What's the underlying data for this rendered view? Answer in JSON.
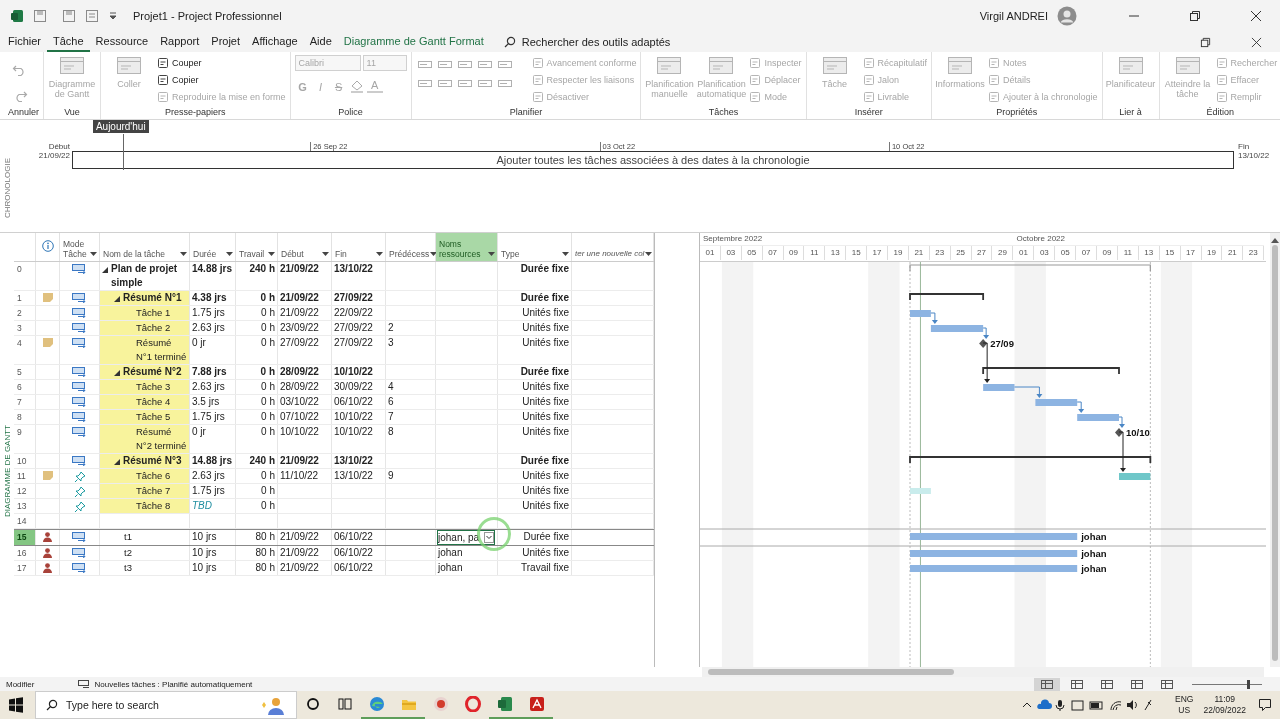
{
  "title_bar": {
    "title": "Projet1 - Project Professionnel",
    "user": "Virgil ANDREI"
  },
  "menu": {
    "tabs": [
      {
        "label": "Fichier",
        "selected": false,
        "kind": "standard"
      },
      {
        "label": "Tâche",
        "selected": true,
        "kind": "standard"
      },
      {
        "label": "Ressource",
        "selected": false,
        "kind": "standard"
      },
      {
        "label": "Rapport",
        "selected": false,
        "kind": "standard"
      },
      {
        "label": "Projet",
        "selected": false,
        "kind": "standard"
      },
      {
        "label": "Affichage",
        "selected": false,
        "kind": "standard"
      },
      {
        "label": "Aide",
        "selected": false,
        "kind": "standard"
      },
      {
        "label": "Diagramme de Gantt Format",
        "selected": false,
        "kind": "contextual"
      }
    ],
    "search": "Rechercher des outils adaptés"
  },
  "ribbon": {
    "groups": [
      {
        "label": "Annuler",
        "items": [
          {
            "kind": "undo",
            "disabled": true
          },
          {
            "kind": "redo",
            "disabled": true
          }
        ]
      },
      {
        "label": "Vue",
        "items": [
          {
            "kind": "large",
            "label": "Diagramme de Gantt",
            "disabled": true
          }
        ]
      },
      {
        "label": "Presse-papiers",
        "items": [
          {
            "kind": "large",
            "label": "Coller",
            "disabled": true
          },
          {
            "kind": "small",
            "label": "Couper",
            "disabled": false
          },
          {
            "kind": "small",
            "label": "Copier",
            "disabled": false
          },
          {
            "kind": "small",
            "label": "Reproduire la mise en forme",
            "disabled": true
          }
        ]
      },
      {
        "label": "Police",
        "items": [
          {
            "kind": "field",
            "label": "Calibri",
            "disabled": true
          },
          {
            "kind": "field",
            "label": "11",
            "disabled": true
          },
          {
            "kind": "bold",
            "label": "G",
            "disabled": true
          },
          {
            "kind": "italic",
            "label": "I",
            "disabled": true
          },
          {
            "kind": "strike",
            "label": "S",
            "disabled": true
          },
          {
            "kind": "fill",
            "disabled": true
          },
          {
            "kind": "fontcolor",
            "label": "A",
            "disabled": true
          }
        ]
      },
      {
        "label": "Planifier",
        "items": [
          {
            "kind": "tool",
            "disabled": true
          },
          {
            "kind": "tool",
            "disabled": true
          },
          {
            "kind": "tool",
            "disabled": true
          },
          {
            "kind": "tool",
            "disabled": true
          },
          {
            "kind": "tool",
            "disabled": true
          },
          {
            "kind": "tool",
            "disabled": true
          },
          {
            "kind": "tool",
            "disabled": true
          },
          {
            "kind": "tool",
            "disabled": true
          },
          {
            "kind": "tool",
            "disabled": true
          },
          {
            "kind": "tool",
            "disabled": true
          },
          {
            "kind": "small",
            "label": "Avancement conforme",
            "disabled": true
          },
          {
            "kind": "small",
            "label": "Respecter les liaisons",
            "disabled": true
          },
          {
            "kind": "small",
            "label": "Désactiver",
            "disabled": true
          }
        ]
      },
      {
        "label": "Tâches",
        "items": [
          {
            "kind": "large",
            "label": "Planification manuelle",
            "disabled": true
          },
          {
            "kind": "large",
            "label": "Planification automatique",
            "disabled": true
          },
          {
            "kind": "small",
            "label": "Inspecter",
            "disabled": true
          },
          {
            "kind": "small",
            "label": "Déplacer",
            "disabled": true
          },
          {
            "kind": "small",
            "label": "Mode",
            "disabled": true
          }
        ]
      },
      {
        "label": "Insérer",
        "items": [
          {
            "kind": "large",
            "label": "Tâche",
            "disabled": true
          },
          {
            "kind": "small",
            "label": "Récapitulatif",
            "disabled": true
          },
          {
            "kind": "small",
            "label": "Jalon",
            "disabled": true
          },
          {
            "kind": "small",
            "label": "Livrable",
            "disabled": true
          }
        ]
      },
      {
        "label": "Propriétés",
        "items": [
          {
            "kind": "large",
            "label": "Informations",
            "disabled": true
          },
          {
            "kind": "small",
            "label": "Notes",
            "disabled": true
          },
          {
            "kind": "small",
            "label": "Détails",
            "disabled": true
          },
          {
            "kind": "small",
            "label": "Ajouter à la chronologie",
            "disabled": true
          }
        ]
      },
      {
        "label": "Lier à",
        "items": [
          {
            "kind": "large",
            "label": "Planificateur",
            "disabled": true
          }
        ]
      },
      {
        "label": "Édition",
        "items": [
          {
            "kind": "large",
            "label": "Atteindre la tâche",
            "disabled": true
          },
          {
            "kind": "small",
            "label": "Rechercher",
            "disabled": true
          },
          {
            "kind": "small",
            "label": "Effacer",
            "disabled": true
          },
          {
            "kind": "small",
            "label": "Remplir",
            "disabled": true
          }
        ]
      }
    ]
  },
  "timeline": {
    "side_label": "CHRONOLOGIE",
    "today": "Aujourd'hui",
    "start_label": "Début",
    "start_date": "21/09/22",
    "end_label": "Fin",
    "end_date": "13/10/22",
    "ticks": [
      "26 Sep 22",
      "03 Oct 22",
      "10 Oct 22"
    ],
    "placeholder": "Ajouter toutes les tâches associées à des dates à la chronologie"
  },
  "table": {
    "side_label": "DIAGRAMME DE GANTT",
    "columns": [
      {
        "kind": "info",
        "selected": false
      },
      {
        "kind": "text",
        "label": "Mode Tâche",
        "selected": false
      },
      {
        "kind": "text",
        "label": "Nom de la tâche",
        "selected": false
      },
      {
        "kind": "text",
        "label": "Durée",
        "selected": false
      },
      {
        "kind": "text",
        "label": "Travail",
        "selected": false
      },
      {
        "kind": "text",
        "label": "Début",
        "selected": false
      },
      {
        "kind": "text",
        "label": "Fin",
        "selected": false
      },
      {
        "kind": "text",
        "label": "Prédécess",
        "selected": false
      },
      {
        "kind": "text",
        "label": "Noms ressources",
        "selected": true
      },
      {
        "kind": "text",
        "label": "Type",
        "selected": false
      },
      {
        "kind": "add",
        "label": "ter une nouvelle col",
        "selected": false
      }
    ],
    "rows": [
      {
        "id": "0",
        "kind": "summary",
        "manual": false,
        "name": "Plan de projet simple",
        "highlighted": false,
        "selected": false,
        "estimated": false,
        "duration": "14.88 jrs",
        "work": "240 h",
        "start": "21/09/22",
        "finish": "13/10/22",
        "type": "Durée fixe",
        "children": [
          {
            "id": "1",
            "kind": "summary",
            "indicator": {
              "kind": "note"
            },
            "manual": false,
            "name": "Résumé N°1",
            "highlighted": true,
            "selected": false,
            "estimated": false,
            "duration": "4.38 jrs",
            "work": "0 h",
            "start": "21/09/22",
            "finish": "27/09/22",
            "type": "Durée fixe",
            "children": [
              {
                "id": "2",
                "kind": "task",
                "manual": false,
                "name": "Tâche 1",
                "highlighted": true,
                "selected": false,
                "estimated": false,
                "duration": "1.75 jrs",
                "work": "0 h",
                "start": "21/09/22",
                "finish": "22/09/22",
                "type": "Unités fixe"
              },
              {
                "id": "3",
                "kind": "task",
                "manual": false,
                "name": "Tâche 2",
                "highlighted": true,
                "selected": false,
                "estimated": false,
                "duration": "2.63 jrs",
                "work": "0 h",
                "start": "23/09/22",
                "finish": "27/09/22",
                "predecessors": "2",
                "type": "Unités fixe"
              },
              {
                "id": "4",
                "kind": "milestone",
                "indicator": {
                  "kind": "note"
                },
                "manual": false,
                "name": "Résumé N°1 terminé",
                "highlighted": true,
                "selected": false,
                "estimated": false,
                "duration": "0 jr",
                "work": "0 h",
                "start": "27/09/22",
                "finish": "27/09/22",
                "predecessors": "3",
                "type": "Unités fixe",
                "bar_label": "27/09"
              }
            ]
          },
          {
            "id": "5",
            "kind": "summary",
            "manual": false,
            "name": "Résumé N°2",
            "highlighted": true,
            "selected": false,
            "estimated": false,
            "duration": "7.88 jrs",
            "work": "0 h",
            "start": "28/09/22",
            "finish": "10/10/22",
            "type": "Durée fixe",
            "children": [
              {
                "id": "6",
                "kind": "task",
                "manual": false,
                "name": "Tâche 3",
                "highlighted": true,
                "selected": false,
                "estimated": false,
                "duration": "2.63 jrs",
                "work": "0 h",
                "start": "28/09/22",
                "finish": "30/09/22",
                "predecessors": "4",
                "type": "Unités fixe"
              },
              {
                "id": "7",
                "kind": "task",
                "manual": false,
                "name": "Tâche 4",
                "highlighted": true,
                "selected": false,
                "estimated": false,
                "duration": "3.5 jrs",
                "work": "0 h",
                "start": "03/10/22",
                "finish": "06/10/22",
                "predecessors": "6",
                "type": "Unités fixe"
              },
              {
                "id": "8",
                "kind": "task",
                "manual": false,
                "name": "Tâche 5",
                "highlighted": true,
                "selected": false,
                "estimated": false,
                "duration": "1.75 jrs",
                "work": "0 h",
                "start": "07/10/22",
                "finish": "10/10/22",
                "predecessors": "7",
                "type": "Unités fixe"
              },
              {
                "id": "9",
                "kind": "milestone",
                "manual": false,
                "name": "Résumé N°2 terminé",
                "highlighted": true,
                "selected": false,
                "estimated": false,
                "duration": "0 jr",
                "work": "0 h",
                "start": "10/10/22",
                "finish": "10/10/22",
                "predecessors": "8",
                "type": "Unités fixe",
                "bar_label": "10/10"
              }
            ]
          },
          {
            "id": "10",
            "kind": "summary",
            "manual": false,
            "name": "Résumé N°3",
            "highlighted": true,
            "selected": false,
            "estimated": false,
            "duration": "14.88 jrs",
            "work": "240 h",
            "start": "21/09/22",
            "finish": "13/10/22",
            "type": "Durée fixe",
            "children": [
              {
                "id": "11",
                "kind": "task",
                "indicator": {
                  "kind": "note"
                },
                "manual": true,
                "name": "Tâche 6",
                "highlighted": true,
                "selected": false,
                "estimated": false,
                "duration": "2.63 jrs",
                "work": "0 h",
                "start": "11/10/22",
                "finish": "13/10/22",
                "predecessors": "9",
                "type": "Unités fixe"
              },
              {
                "id": "12",
                "kind": "task",
                "manual": true,
                "name": "Tâche 7",
                "highlighted": true,
                "selected": false,
                "estimated": false,
                "duration": "1.75 jrs",
                "work": "0 h",
                "type": "Unités fixe"
              },
              {
                "id": "13",
                "kind": "task",
                "manual": true,
                "name": "Tâche 8",
                "highlighted": true,
                "selected": false,
                "estimated": true,
                "duration": "TBD",
                "work": "0 h",
                "type": "Unités fixe"
              }
            ]
          },
          {
            "id": "14",
            "kind": "blank",
            "highlighted": false,
            "selected": false
          },
          {
            "id": "15",
            "kind": "task",
            "indicator": {
              "kind": "person"
            },
            "manual": false,
            "name": "t1",
            "highlighted": false,
            "selected": true,
            "estimated": false,
            "duration": "10 jrs",
            "work": "80 h",
            "start": "21/09/22",
            "finish": "06/10/22",
            "resources": "johan, pa",
            "type": "Durée fixe",
            "bar_label": "johan"
          },
          {
            "id": "16",
            "kind": "task",
            "indicator": {
              "kind": "person"
            },
            "manual": false,
            "name": "t2",
            "highlighted": false,
            "selected": false,
            "estimated": false,
            "duration": "10 jrs",
            "work": "80 h",
            "start": "21/09/22",
            "finish": "06/10/22",
            "resources": "johan",
            "type": "Unités fixe",
            "bar_label": "johan"
          },
          {
            "id": "17",
            "kind": "task",
            "indicator": {
              "kind": "person"
            },
            "manual": false,
            "name": "t3",
            "highlighted": false,
            "selected": false,
            "estimated": false,
            "duration": "10 jrs",
            "work": "80 h",
            "start": "21/09/22",
            "finish": "06/10/22",
            "resources": "johan",
            "type": "Travail fixe",
            "bar_label": "johan"
          }
        ]
      }
    ]
  },
  "gantt": {
    "months": [
      {
        "label": "Septembre 2022",
        "days": [
          "01",
          "03",
          "05",
          "07",
          "09",
          "11",
          "13",
          "15",
          "17",
          "19",
          "21",
          "23",
          "25",
          "27",
          "29"
        ]
      },
      {
        "label": "Octobre 2022",
        "days": [
          "01",
          "03",
          "05",
          "07",
          "09",
          "11",
          "13",
          "15",
          "17",
          "19",
          "21",
          "23"
        ]
      }
    ]
  },
  "status_bar": {
    "mode": "Modifier",
    "new_tasks": "Nouvelles tâches : Planifié automatiquement",
    "views": [
      {
        "selected": true
      },
      {
        "selected": false
      },
      {
        "selected": false
      },
      {
        "selected": false
      },
      {
        "selected": false
      }
    ],
    "zoom": {
      "level": 0.8
    }
  },
  "taskbar": {
    "search_placeholder": "Type here to search",
    "apps": [
      {
        "kind": "cortana",
        "open": false
      },
      {
        "kind": "task-view",
        "open": false
      },
      {
        "kind": "edge",
        "open": true
      },
      {
        "kind": "explorer",
        "open": true
      },
      {
        "kind": "recorder",
        "open": false
      },
      {
        "kind": "opera",
        "open": false
      },
      {
        "kind": "project",
        "open": true
      },
      {
        "kind": "acrobat",
        "open": true
      }
    ],
    "language": "ENG",
    "region": "US",
    "time": "11:09",
    "date": "22/09/2022"
  }
}
